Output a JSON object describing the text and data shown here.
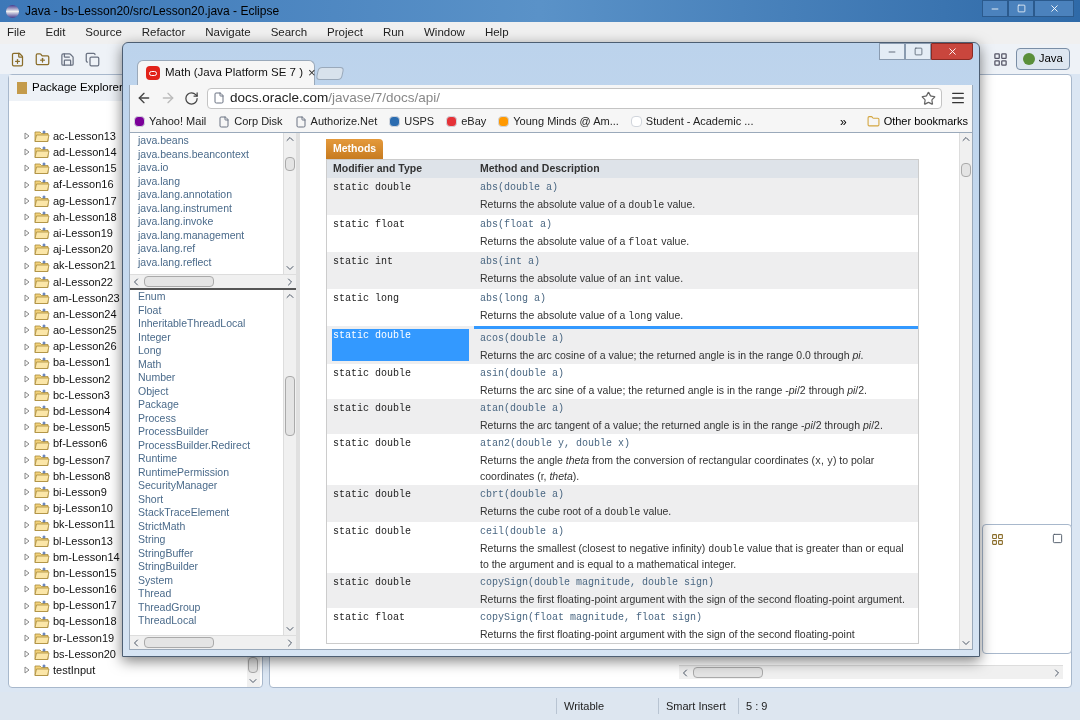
{
  "window": {
    "title": "Java - bs-Lesson20/src/Lesson20.java - Eclipse"
  },
  "menu": [
    "File",
    "Edit",
    "Source",
    "Refactor",
    "Navigate",
    "Search",
    "Project",
    "Run",
    "Window",
    "Help"
  ],
  "perspective": {
    "label": "Java",
    "selected": true
  },
  "package_explorer": {
    "title": "Package Explorer",
    "items": [
      {
        "label": "ac-Lesson13",
        "expanded": false
      },
      {
        "label": "ad-Lesson14",
        "expanded": false
      },
      {
        "label": "ae-Lesson15",
        "expanded": false
      },
      {
        "label": "af-Lesson16",
        "expanded": false
      },
      {
        "label": "ag-Lesson17",
        "expanded": false
      },
      {
        "label": "ah-Lesson18",
        "expanded": false
      },
      {
        "label": "ai-Lesson19",
        "expanded": false
      },
      {
        "label": "aj-Lesson20",
        "expanded": false
      },
      {
        "label": "ak-Lesson21",
        "expanded": false
      },
      {
        "label": "al-Lesson22",
        "expanded": false
      },
      {
        "label": "am-Lesson23",
        "expanded": false
      },
      {
        "label": "an-Lesson24",
        "expanded": false
      },
      {
        "label": "ao-Lesson25",
        "expanded": false
      },
      {
        "label": "ap-Lesson26",
        "expanded": false
      },
      {
        "label": "ba-Lesson1",
        "expanded": false
      },
      {
        "label": "bb-Lesson2",
        "expanded": false
      },
      {
        "label": "bc-Lesson3",
        "expanded": false
      },
      {
        "label": "bd-Lesson4",
        "expanded": false
      },
      {
        "label": "be-Lesson5",
        "expanded": false
      },
      {
        "label": "bf-Lesson6",
        "expanded": false
      },
      {
        "label": "bg-Lesson7",
        "expanded": false
      },
      {
        "label": "bh-Lesson8",
        "expanded": false
      },
      {
        "label": "bi-Lesson9",
        "expanded": false
      },
      {
        "label": "bj-Lesson10",
        "expanded": false
      },
      {
        "label": "bk-Lesson11",
        "expanded": false
      },
      {
        "label": "bl-Lesson13",
        "expanded": false
      },
      {
        "label": "bm-Lesson14",
        "expanded": false
      },
      {
        "label": "bn-Lesson15",
        "expanded": false
      },
      {
        "label": "bo-Lesson16",
        "expanded": false
      },
      {
        "label": "bp-Lesson17",
        "expanded": false
      },
      {
        "label": "bq-Lesson18",
        "expanded": false
      },
      {
        "label": "br-Lesson19",
        "expanded": false
      },
      {
        "label": "bs-Lesson20",
        "expanded": false
      },
      {
        "label": "testInput",
        "expanded": false
      }
    ]
  },
  "status_bar": [
    "Writable",
    "Smart Insert",
    "5 : 9"
  ],
  "browser": {
    "tab": {
      "title": "Math (Java Platform SE 7 )",
      "close": "×",
      "selected": true
    },
    "url": {
      "host": "docs.oracle.com",
      "path": "/javase/7/docs/api/"
    },
    "bookmarks": [
      "Yahoo! Mail",
      "Corp Disk",
      "Authorize.Net",
      "USPS",
      "eBay",
      "Young Minds @ Am...",
      "Student - Academic ..."
    ],
    "more_bookmarks": "»",
    "other_bookmarks": "Other bookmarks",
    "packages": [
      "java.beans",
      "java.beans.beancontext",
      "java.io",
      "java.lang",
      "java.lang.annotation",
      "java.lang.instrument",
      "java.lang.invoke",
      "java.lang.management",
      "java.lang.ref",
      "java.lang.reflect"
    ],
    "classes": [
      "Enum",
      "Float",
      "InheritableThreadLocal",
      "Integer",
      "Long",
      "Math",
      "Number",
      "Object",
      "Package",
      "Process",
      "ProcessBuilder",
      "ProcessBuilder.Redirect",
      "Runtime",
      "RuntimePermission",
      "SecurityManager",
      "Short",
      "StackTraceElement",
      "StrictMath",
      "String",
      "StringBuffer",
      "StringBuilder",
      "System",
      "Thread",
      "ThreadGroup",
      "ThreadLocal"
    ],
    "methods": {
      "caption": "Methods",
      "columns": [
        "Modifier and Type",
        "Method and Description"
      ],
      "rows": [
        {
          "modifier": "static double",
          "method": "abs(double a)",
          "selected": false,
          "description": [
            {
              "kind": "text",
              "text": "Returns the absolute value of a "
            },
            {
              "kind": "code",
              "text": "double"
            },
            {
              "kind": "text",
              "text": " value."
            }
          ]
        },
        {
          "modifier": "static float",
          "method": "abs(float a)",
          "selected": false,
          "description": [
            {
              "kind": "text",
              "text": "Returns the absolute value of a "
            },
            {
              "kind": "code",
              "text": "float"
            },
            {
              "kind": "text",
              "text": " value."
            }
          ]
        },
        {
          "modifier": "static int",
          "method": "abs(int a)",
          "selected": false,
          "description": [
            {
              "kind": "text",
              "text": "Returns the absolute value of an "
            },
            {
              "kind": "code",
              "text": "int"
            },
            {
              "kind": "text",
              "text": " value."
            }
          ]
        },
        {
          "modifier": "static long",
          "method": "abs(long a)",
          "selected": false,
          "description": [
            {
              "kind": "text",
              "text": "Returns the absolute value of a "
            },
            {
              "kind": "code",
              "text": "long"
            },
            {
              "kind": "text",
              "text": " value."
            }
          ]
        },
        {
          "modifier": "static double",
          "method": "acos(double a)",
          "selected": true,
          "description": [
            {
              "kind": "text",
              "text": "Returns the arc cosine of a value; the returned angle is in the range 0.0 through *pi*."
            }
          ]
        },
        {
          "modifier": "static double",
          "method": "asin(double a)",
          "selected": false,
          "description": [
            {
              "kind": "text",
              "text": "Returns the arc sine of a value; the returned angle is in the range -*pi*/2 through *pi*/2."
            }
          ]
        },
        {
          "modifier": "static double",
          "method": "atan(double a)",
          "selected": false,
          "description": [
            {
              "kind": "text",
              "text": "Returns the arc tangent of a value; the returned angle is in the range -*pi*/2 through *pi*/2."
            }
          ]
        },
        {
          "modifier": "static double",
          "method": "atan2(double y, double x)",
          "selected": false,
          "description": [
            {
              "kind": "text",
              "text": "Returns the angle *theta* from the conversion of rectangular coordinates ("
            },
            {
              "kind": "code",
              "text": "x"
            },
            {
              "kind": "text",
              "text": ", "
            },
            {
              "kind": "code",
              "text": "y"
            },
            {
              "kind": "text",
              "text": ") to polar coordinates (r, *theta*)."
            }
          ]
        },
        {
          "modifier": "static double",
          "method": "cbrt(double a)",
          "selected": false,
          "description": [
            {
              "kind": "text",
              "text": "Returns the cube root of a "
            },
            {
              "kind": "code",
              "text": "double"
            },
            {
              "kind": "text",
              "text": " value."
            }
          ]
        },
        {
          "modifier": "static double",
          "method": "ceil(double a)",
          "selected": false,
          "description": [
            {
              "kind": "text",
              "text": "Returns the smallest (closest to negative infinity) "
            },
            {
              "kind": "code",
              "text": "double"
            },
            {
              "kind": "text",
              "text": " value that is greater than or equal to the argument and is equal to a mathematical integer."
            }
          ]
        },
        {
          "modifier": "static double",
          "method": "copySign(double magnitude, double sign)",
          "selected": false,
          "description": [
            {
              "kind": "text",
              "text": "Returns the first floating-point argument with the sign of the second floating-point argument."
            }
          ]
        },
        {
          "modifier": "static float",
          "method": "copySign(float magnitude, float sign)",
          "selected": false,
          "description": [
            {
              "kind": "text",
              "text": "Returns the first floating-point argument with the sign of the second floating-point"
            }
          ]
        }
      ]
    }
  }
}
